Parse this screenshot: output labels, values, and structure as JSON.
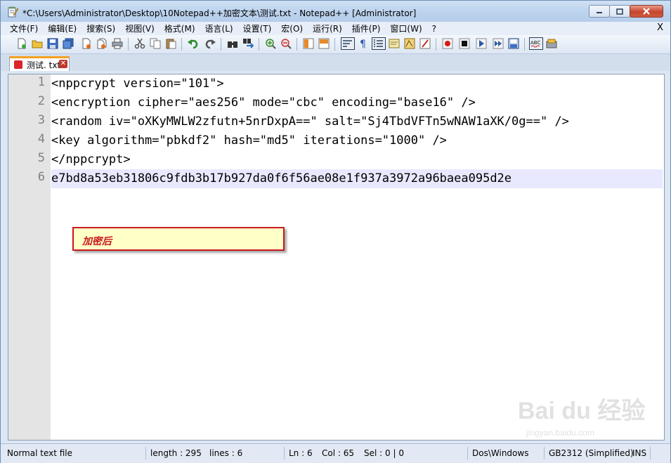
{
  "window": {
    "title": "*C:\\Users\\Administrator\\Desktop\\10Notepad++加密文本\\测试.txt - Notepad++ [Administrator]"
  },
  "menubar": {
    "items": [
      "文件(F)",
      "编辑(E)",
      "搜索(S)",
      "视图(V)",
      "格式(M)",
      "语言(L)",
      "设置(T)",
      "宏(O)",
      "运行(R)",
      "插件(P)",
      "窗口(W)",
      "?"
    ],
    "close": "X"
  },
  "tab": {
    "label": "测试. txt"
  },
  "editor": {
    "lines": [
      {
        "no": "1",
        "text": "<nppcrypt version=\"101\">"
      },
      {
        "no": "2",
        "text": "<encryption cipher=\"aes256\" mode=\"cbc\" encoding=\"base16\" />"
      },
      {
        "no": "3",
        "text": "<random iv=\"oXKyMWLW2zfutn+5nrDxpA==\" salt=\"Sj4TbdVFTn5wNAW1aXK/0g==\" />"
      },
      {
        "no": "4",
        "text": "<key algorithm=\"pbkdf2\" hash=\"md5\" iterations=\"1000\" />"
      },
      {
        "no": "5",
        "text": "</nppcrypt>"
      },
      {
        "no": "6",
        "text": "e7bd8a53eb31806c9fdb3b17b927da0f6f56ae08e1f937a3972a96baea095d2e"
      }
    ],
    "current_line": 6
  },
  "annotation": {
    "text": "加密后"
  },
  "watermark": {
    "main": "Bai du 经验",
    "sub": "jingyan.baidu.com"
  },
  "statusbar": {
    "type": "Normal text file",
    "length": "length : 295",
    "lines": "lines : 6",
    "ln": "Ln : 6",
    "col": "Col : 65",
    "sel": "Sel : 0 | 0",
    "eol": "Dos\\Windows",
    "encoding": "GB2312 (Simplified)",
    "mode": "INS"
  },
  "icons": [
    "notepad-app-icon",
    "new-file-icon",
    "open-file-icon",
    "save-icon",
    "save-all-icon",
    "close-icon",
    "close-all-icon",
    "print-icon",
    "cut-icon",
    "copy-icon",
    "paste-icon",
    "undo-icon",
    "redo-icon",
    "find-icon",
    "replace-icon",
    "zoom-in-icon",
    "zoom-out-icon",
    "sync-v-icon",
    "sync-h-icon",
    "word-wrap-icon",
    "show-all-chars-icon",
    "indent-guide-icon",
    "function-list-icon",
    "doc-map-icon",
    "folder-workspace-icon",
    "record-macro-icon",
    "stop-record-icon",
    "play-macro-icon",
    "run-macro-multiple-icon",
    "save-macro-icon",
    "spell-check-icon",
    "spell-setting-icon"
  ],
  "colors": {
    "accent_tab": "#f5a020",
    "callout_border": "#c8191d",
    "callout_bg": "#ffffc8",
    "current_line": "#e8e8ff"
  }
}
